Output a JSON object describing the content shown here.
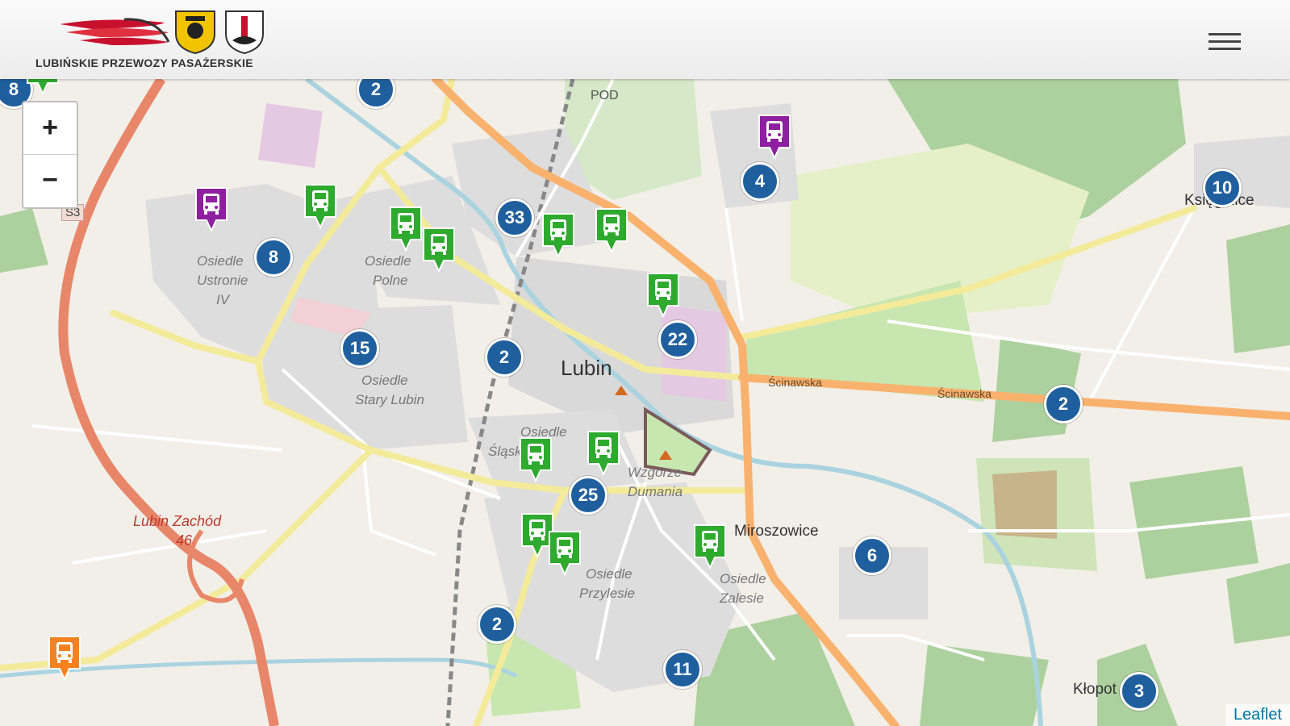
{
  "header": {
    "logo_text": "LUBIŃSKIE PRZEWOZY PASAŻERSKIE",
    "menu_icon": "hamburger-menu-icon"
  },
  "map": {
    "zoom_in_label": "+",
    "zoom_out_label": "−",
    "attribution": "Leaflet",
    "places": {
      "city": "Lubin",
      "miroszowice": "Miroszowice",
      "ksiginice": "Księginice",
      "klopot": "Kłopot",
      "pod": "POD",
      "lubin_zachod": "Lubin Zachód",
      "exit_num": "46",
      "s3": "S3",
      "sciniawska_1": "Ścinawska",
      "sciniawska_2": "Ścinawska",
      "ustronie_1": "Osiedle",
      "ustronie_2": "Ustronie",
      "ustronie_3": "IV",
      "polne_1": "Osiedle",
      "polne_2": "Polne",
      "stary_1": "Osiedle",
      "stary_2": "Stary Lubin",
      "slaskie_1": "Osiedle",
      "slaskie_2": "Śląskie",
      "wzgorze_1": "Wzgórze",
      "wzgorze_2": "Dumania",
      "przylesie_1": "Osiedle",
      "przylesie_2": "Przylesie",
      "zalesie_1": "Osiedle",
      "zalesie_2": "Zalesie"
    },
    "clusters": [
      "2",
      "8",
      "8",
      "33",
      "4",
      "10",
      "15",
      "2",
      "22",
      "2",
      "25",
      "6",
      "2",
      "11",
      "3"
    ],
    "marker_colors": {
      "green": "#2eaa2e",
      "purple": "#8e1fa0",
      "orange": "#f5821f",
      "cluster": "#1f5f9e"
    }
  }
}
